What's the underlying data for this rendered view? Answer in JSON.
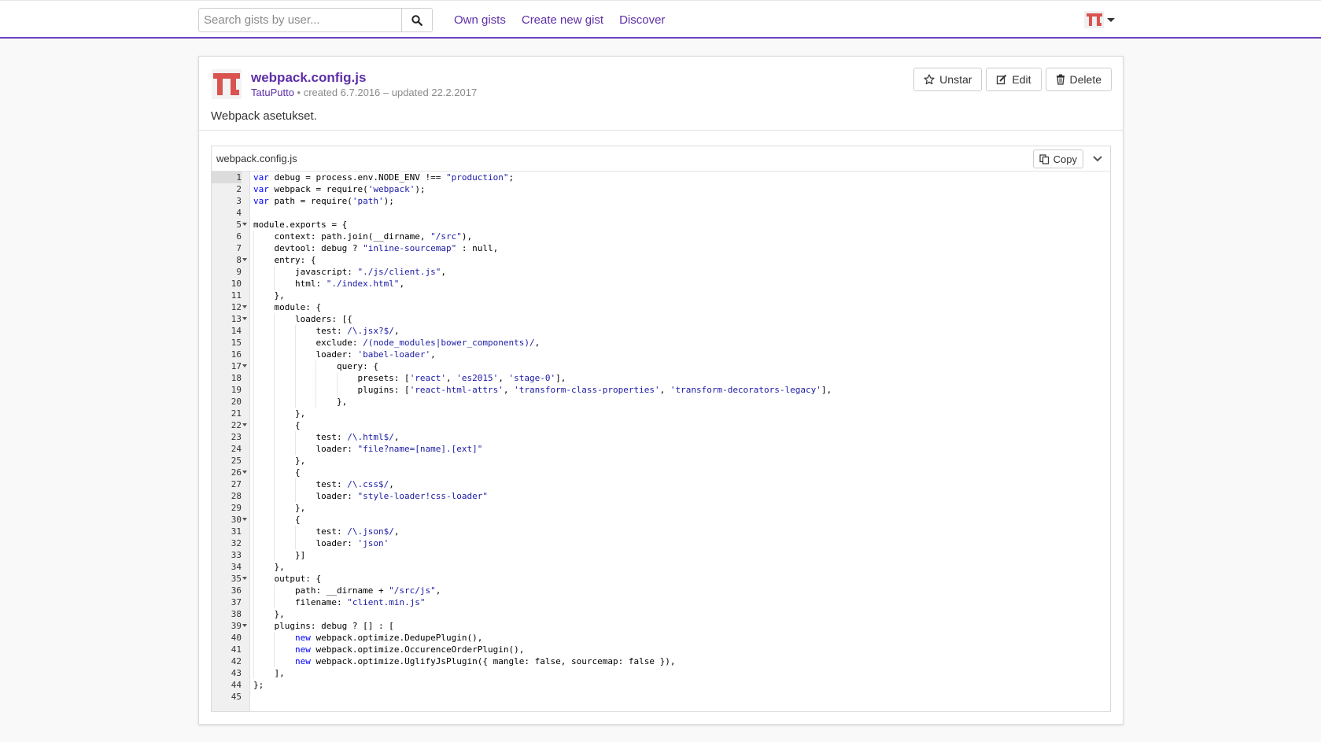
{
  "navbar": {
    "search_placeholder": "Search gists by user...",
    "links": [
      "Own gists",
      "Create new gist",
      "Discover"
    ]
  },
  "gist": {
    "title": "webpack.config.js",
    "owner": "TatuPutto",
    "meta": " • created 6.7.2016 – updated 22.2.2017",
    "description": "Webpack asetukset.",
    "buttons": {
      "unstar": "Unstar",
      "edit": "Edit",
      "delete": "Delete"
    }
  },
  "file": {
    "name": "webpack.config.js",
    "copy_label": "Copy",
    "active_line": 1,
    "fold_lines": [
      5,
      8,
      12,
      13,
      17,
      22,
      26,
      30,
      35,
      39
    ],
    "lines": [
      "var debug = process.env.NODE_ENV !== \"production\";",
      "var webpack = require('webpack');",
      "var path = require('path');",
      "",
      "module.exports = {",
      "    context: path.join(__dirname, \"/src\"),",
      "    devtool: debug ? \"inline-sourcemap\" : null,",
      "    entry: {",
      "        javascript: \"./js/client.js\",",
      "        html: \"./index.html\",",
      "    },",
      "    module: {",
      "        loaders: [{",
      "            test: /\\.jsx?$/,",
      "            exclude: /(node_modules|bower_components)/,",
      "            loader: 'babel-loader',",
      "                query: {",
      "                    presets: ['react', 'es2015', 'stage-0'],",
      "                    plugins: ['react-html-attrs', 'transform-class-properties', 'transform-decorators-legacy'],",
      "                },",
      "        },",
      "        {",
      "            test: /\\.html$/,",
      "            loader: \"file?name=[name].[ext]\"",
      "        },",
      "        {",
      "            test: /\\.css$/,",
      "            loader: \"style-loader!css-loader\"",
      "        },",
      "        {",
      "            test: /\\.json$/,",
      "            loader: 'json'",
      "        }]",
      "    },",
      "    output: {",
      "        path: __dirname + \"/src/js\",",
      "        filename: \"client.min.js\"",
      "    },",
      "    plugins: debug ? [] : [",
      "        new webpack.optimize.DedupePlugin(),",
      "        new webpack.optimize.OccurenceOrderPlugin(),",
      "        new webpack.optimize.UglifyJsPlugin({ mangle: false, sourcemap: false }),",
      "    ],",
      "};",
      ""
    ]
  },
  "colors": {
    "accent": "#6f42c1",
    "link": "#5e2fa8",
    "string": "#1a1aa6",
    "keyword": "#0000ff",
    "logo": "#d9534f"
  }
}
